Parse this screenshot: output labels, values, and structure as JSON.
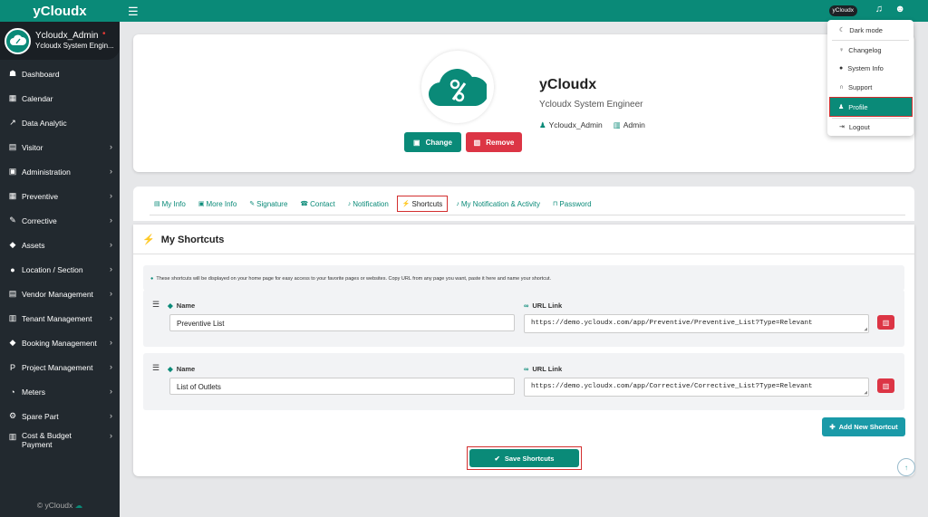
{
  "brand": {
    "name": "yCloudx"
  },
  "user": {
    "name": "Ycloudx_Admin",
    "role": "Ycloudx System Engin..."
  },
  "sidebar": {
    "items": [
      {
        "label": "Dashboard",
        "icon": "tachometer-icon",
        "glyph": "⚒",
        "chevron": false
      },
      {
        "label": "Calendar",
        "icon": "calendar-icon",
        "glyph": "▦",
        "chevron": false
      },
      {
        "label": "Data Analytic",
        "icon": "line-chart-icon",
        "glyph": "↗",
        "chevron": false
      },
      {
        "label": "Visitor",
        "icon": "id-card-icon",
        "glyph": "▤",
        "chevron": true
      },
      {
        "label": "Administration",
        "icon": "user-square-icon",
        "glyph": "▣",
        "chevron": true
      },
      {
        "label": "Preventive",
        "icon": "calendar-check-icon",
        "glyph": "▦",
        "chevron": true
      },
      {
        "label": "Corrective",
        "icon": "wrench-icon",
        "glyph": "⚒",
        "chevron": true
      },
      {
        "label": "Assets",
        "icon": "tag-icon",
        "glyph": "◆",
        "chevron": true
      },
      {
        "label": "Location / Section",
        "icon": "globe-icon",
        "glyph": "●",
        "chevron": true
      },
      {
        "label": "Vendor Management",
        "icon": "vendor-card-icon",
        "glyph": "▤",
        "chevron": true
      },
      {
        "label": "Tenant Management",
        "icon": "building-icon",
        "glyph": "▥",
        "chevron": true
      },
      {
        "label": "Booking Management",
        "icon": "booking-tag-icon",
        "glyph": "◆",
        "chevron": true
      },
      {
        "label": "Project Management",
        "icon": "project-icon",
        "glyph": "P",
        "chevron": true
      },
      {
        "label": "Meters",
        "icon": "gauge-icon",
        "glyph": "◔",
        "chevron": true
      },
      {
        "label": "Spare Part",
        "icon": "spare-part-icon",
        "glyph": "⚙",
        "chevron": true
      }
    ],
    "cost": {
      "line1": "Cost & Budget",
      "line2": "Payment"
    },
    "footer": "© yCloudx"
  },
  "topbar": {
    "pill": "yCloudx"
  },
  "profile": {
    "title": "yCloudx",
    "subtitle": "Ycloudx System Engineer",
    "username": "Ycloudx_Admin",
    "userrole": "Admin",
    "change_label": "Change",
    "remove_label": "Remove"
  },
  "tabs": [
    {
      "label": "My Info",
      "glyph": "▤",
      "active": false
    },
    {
      "label": "More Info",
      "glyph": "▣",
      "active": false
    },
    {
      "label": "Signature",
      "glyph": "✎",
      "active": false
    },
    {
      "label": "Contact",
      "glyph": "☎",
      "active": false
    },
    {
      "label": "Notification",
      "glyph": "♪",
      "active": false
    },
    {
      "label": "Shortcuts",
      "glyph": "⚡",
      "active": true
    },
    {
      "label": "My Notification & Activity",
      "glyph": "♪",
      "active": false
    },
    {
      "label": "Password",
      "glyph": "☐",
      "active": false
    }
  ],
  "shortcuts": {
    "title": "My Shortcuts",
    "info": "These shortcuts will be displayed on your home page for easy access to your favorite pages or websites. Copy URL from any page you want, paste it here and name your shortcut.",
    "name_label": "Name",
    "url_label": "URL Link",
    "rows": [
      {
        "name": "Preventive List",
        "url": "https://demo.ycloudx.com/app/Preventive/Preventive_List?Type=Relevant"
      },
      {
        "name": "List of Outlets",
        "url": "https://demo.ycloudx.com/app/Corrective/Corrective_List?Type=Relevant"
      }
    ],
    "add_label": "Add New Shortcut",
    "save_label": "Save Shortcuts"
  },
  "menu": {
    "items": [
      {
        "label": "Dark mode",
        "glyph": "☾"
      },
      {
        "label": "Changelog",
        "glyph": "⚐"
      },
      {
        "label": "System Info",
        "glyph": "ⓘ"
      },
      {
        "label": "Support",
        "glyph": "☊"
      },
      {
        "label": "Profile",
        "glyph": "☺"
      },
      {
        "label": "Logout",
        "glyph": "⇥"
      }
    ]
  },
  "colors": {
    "accent": "#0a8a78",
    "danger": "#dc3545",
    "sidebar": "#22292f",
    "highlight": "#d32f2f"
  }
}
